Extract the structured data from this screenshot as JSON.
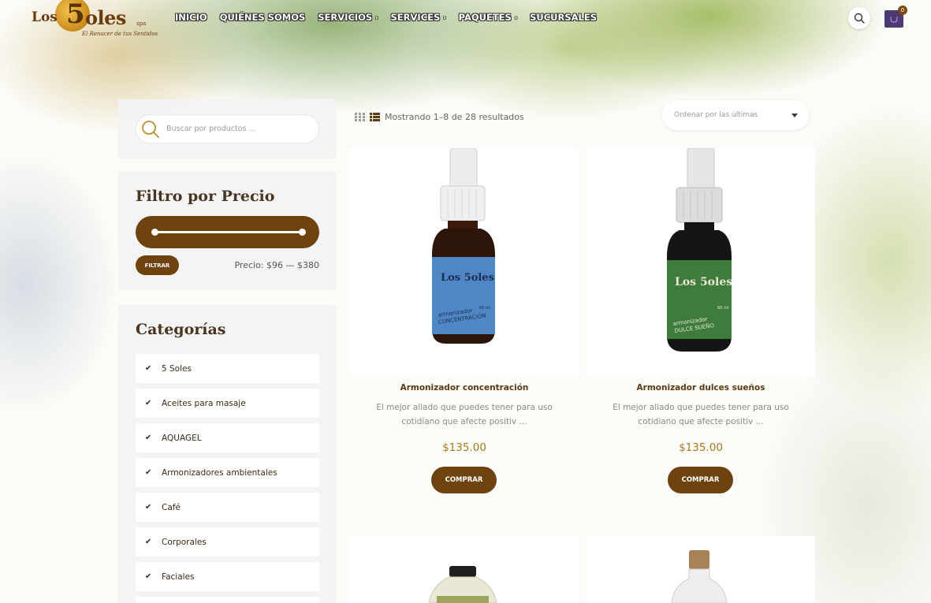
{
  "header": {
    "logo": {
      "los": "Los",
      "five": "5",
      "soles": "oles",
      "spa": "spa",
      "tagline": "El Renacer de tus Sentidos"
    },
    "nav": [
      {
        "label": "INICIO",
        "has_submenu": false
      },
      {
        "label": "QUIÉNES SOMOS",
        "has_submenu": false
      },
      {
        "label": "SERVICIOS",
        "has_submenu": true
      },
      {
        "label": "SERVICES",
        "has_submenu": true
      },
      {
        "label": "PAQUETES",
        "has_submenu": true
      },
      {
        "label": "SUCURSALES",
        "has_submenu": false
      }
    ],
    "search_icon": "search-icon",
    "cart": {
      "icon": "cart-icon",
      "count": "0"
    }
  },
  "sidebar": {
    "search": {
      "placeholder": "Buscar por productos ..."
    },
    "price_filter": {
      "title": "Filtro por Precio",
      "button_label": "FILTRAR",
      "range_text": "Precio: $96 — $380"
    },
    "categories": {
      "title": "Categorías",
      "items": [
        {
          "label": "5 Soles"
        },
        {
          "label": "Aceites para masaje"
        },
        {
          "label": "AQUAGEL"
        },
        {
          "label": "Armonizadores ambientales"
        },
        {
          "label": "Café"
        },
        {
          "label": "Corporales"
        },
        {
          "label": "Faciales"
        }
      ]
    }
  },
  "toolbar": {
    "results_text": "Mostrando 1–8 de 28 resultados",
    "orderby_label": "Ordenar por las últimas"
  },
  "products": [
    {
      "title": "Armonizador concentración",
      "description": "El mejor aliado que puedes tener para uso cotidiano que afecte positiv ...",
      "price": "$135.00",
      "button_label": "COMPRAR",
      "label_color": "#4f86c6",
      "label_text_top": "armonizador",
      "label_text_bottom": "CONCENTRACIÓN",
      "volume": "60 ml"
    },
    {
      "title": "Armonizador dulces sueños",
      "description": "El mejor aliado que puedes tener para uso cotidiano que afecte positiv ...",
      "price": "$135.00",
      "button_label": "COMPRAR",
      "label_color": "#3f7b3a",
      "label_text_top": "armonizador",
      "label_text_bottom": "DULCE SUEÑO",
      "volume": "60 ml"
    }
  ],
  "colors": {
    "brand_brown": "#6e4310",
    "price_gold": "#a87a1e",
    "cart_purple": "#4c3a73"
  }
}
